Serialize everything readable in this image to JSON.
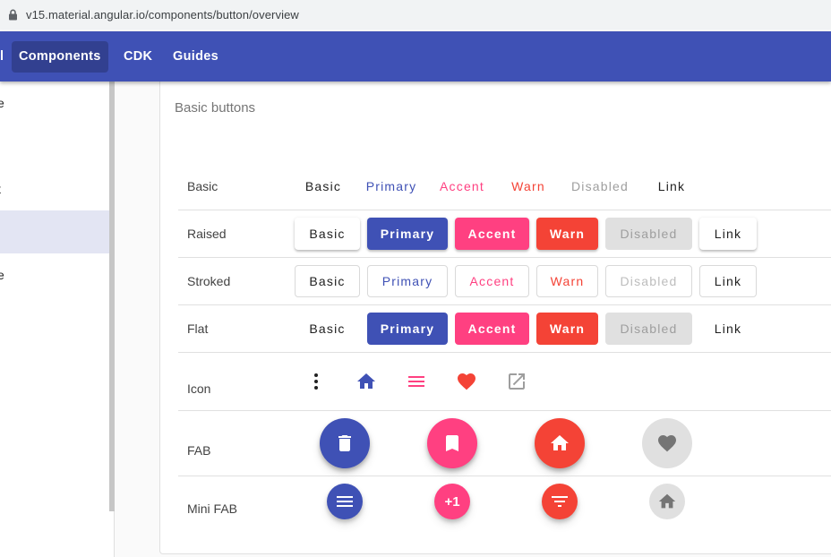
{
  "browser": {
    "url": "v15.material.angular.io/components/button/overview"
  },
  "nav": {
    "cut_label": "l",
    "items": [
      {
        "label": "Components"
      },
      {
        "label": "CDK"
      },
      {
        "label": "Guides"
      }
    ]
  },
  "sidebar": {
    "items": [
      {
        "label": "e"
      },
      {
        "label": "t"
      },
      {
        "label": ""
      },
      {
        "label": "e"
      }
    ]
  },
  "card": {
    "title": "Basic buttons"
  },
  "rows": {
    "basic": {
      "label": "Basic",
      "buttons": [
        "Basic",
        "Primary",
        "Accent",
        "Warn",
        "Disabled",
        "Link"
      ]
    },
    "raised": {
      "label": "Raised",
      "buttons": [
        "Basic",
        "Primary",
        "Accent",
        "Warn",
        "Disabled",
        "Link"
      ]
    },
    "stroked": {
      "label": "Stroked",
      "buttons": [
        "Basic",
        "Primary",
        "Accent",
        "Warn",
        "Disabled",
        "Link"
      ]
    },
    "flat": {
      "label": "Flat",
      "buttons": [
        "Basic",
        "Primary",
        "Accent",
        "Warn",
        "Disabled",
        "Link"
      ]
    },
    "icon": {
      "label": "Icon",
      "icons": [
        "more-vert-icon",
        "home-icon",
        "menu-icon",
        "favorite-icon",
        "open-in-new-icon"
      ]
    },
    "fab": {
      "label": "FAB",
      "icons": [
        "delete-icon",
        "bookmark-icon",
        "home-icon",
        "favorite-icon"
      ]
    },
    "mini_fab": {
      "label": "Mini FAB",
      "icons": [
        "menu-icon",
        "plus-one-icon",
        "filter-list-icon",
        "home-icon"
      ],
      "plus_one_text": "+1"
    }
  },
  "colors": {
    "primary": "#3f51b5",
    "accent": "#ff4081",
    "warn": "#f44336",
    "disabled_bg": "#e0e0e0",
    "disabled_text": "#9e9e9e"
  }
}
